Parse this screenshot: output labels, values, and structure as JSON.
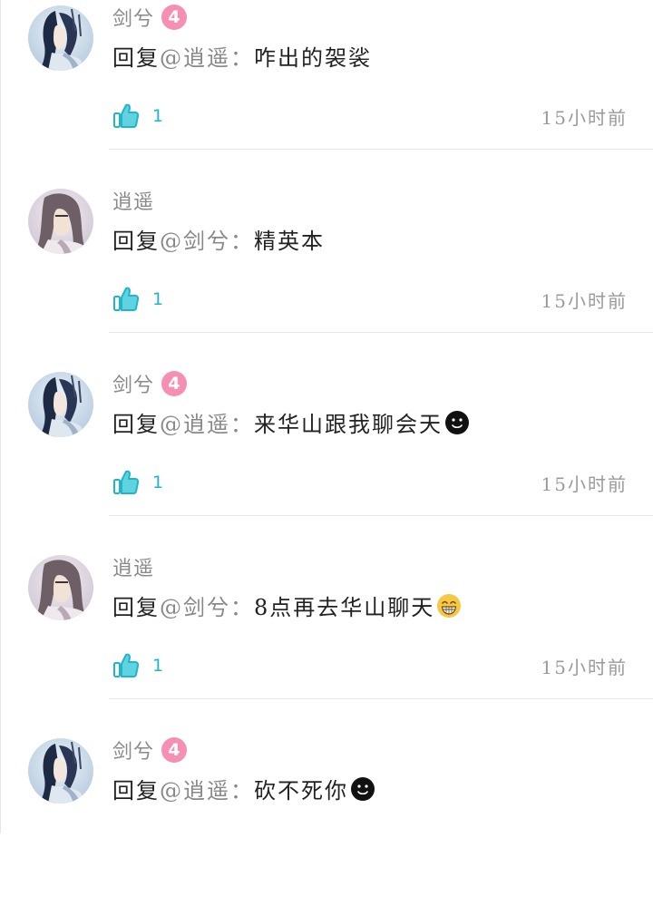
{
  "comments": [
    {
      "user": "剑兮",
      "avatar": "swordsman-avatar",
      "level": "4",
      "reply_prefix": "回复",
      "mention": "@逍遥：",
      "text": "咋出的袈裟",
      "emoji": "",
      "likes": "1",
      "time": "15小时前"
    },
    {
      "user": "逍遥",
      "avatar": "scholar-avatar",
      "level": "",
      "reply_prefix": "回复",
      "mention": "@剑兮：",
      "text": "精英本",
      "emoji": "",
      "likes": "1",
      "time": "15小时前"
    },
    {
      "user": "剑兮",
      "avatar": "swordsman-avatar",
      "level": "4",
      "reply_prefix": "回复",
      "mention": "@逍遥：",
      "text": "来华山跟我聊会天",
      "emoji": "dark-smile-emoji",
      "likes": "1",
      "time": "15小时前"
    },
    {
      "user": "逍遥",
      "avatar": "scholar-avatar",
      "level": "",
      "reply_prefix": "回复",
      "mention": "@剑兮：",
      "text": "8点再去华山聊天",
      "emoji": "grin-emoji",
      "likes": "1",
      "time": "15小时前"
    },
    {
      "user": "剑兮",
      "avatar": "swordsman-avatar",
      "level": "4",
      "reply_prefix": "回复",
      "mention": "@逍遥：",
      "text": "砍不死你",
      "emoji": "dark-smile-emoji",
      "likes": "",
      "time": ""
    }
  ],
  "colors": {
    "like_accent": "#22b4c8",
    "level_badge": "#f58fb4",
    "username": "#8a8a8a",
    "timestamp": "#9a9a9a"
  }
}
